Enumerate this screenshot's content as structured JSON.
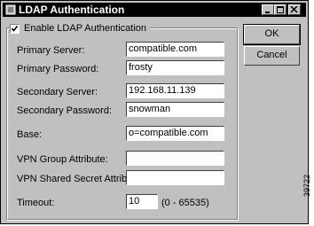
{
  "window": {
    "title": "LDAP Authentication"
  },
  "form": {
    "enable_ldap_label": "Enable LDAP Authentication",
    "enable_ldap_checked": true,
    "fields": [
      {
        "label": "Primary Server:",
        "value": "compatible.com"
      },
      {
        "label": "Primary Password:",
        "value": "frosty"
      },
      {
        "label": "Secondary Server:",
        "value": "192.168.11.139"
      },
      {
        "label": "Secondary Password:",
        "value": "snowman"
      },
      {
        "label": "Base:",
        "value": "o=compatible.com"
      },
      {
        "label": "VPN Group Attribute:",
        "value": ""
      },
      {
        "label": "VPN Shared Secret Attribute:",
        "value": ""
      },
      {
        "label": "Timeout:",
        "value": "10"
      }
    ],
    "timeout_range": "(0 - 65535)"
  },
  "buttons": {
    "ok": "OK",
    "cancel": "Cancel"
  },
  "figure_code": "39722"
}
